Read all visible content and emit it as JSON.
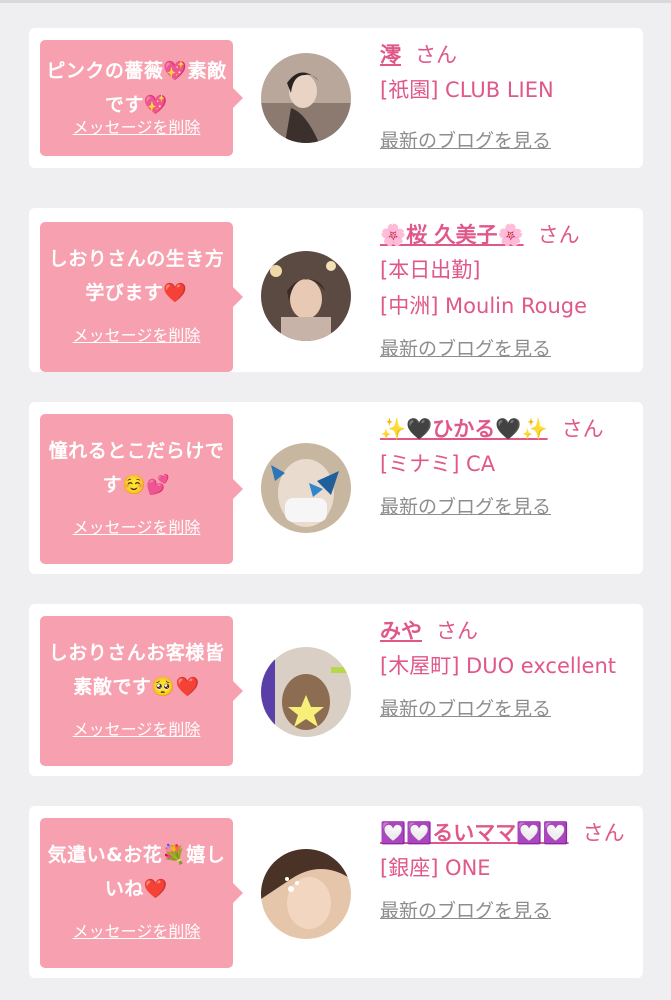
{
  "common": {
    "delete_label": "メッセージを削除",
    "blog_label": "最新のブログを見る",
    "honorific": "さん"
  },
  "colors": {
    "bubble": "#f7a1b0",
    "accent": "#e0578a",
    "muted": "#8d8d8d",
    "background": "#efeff1"
  },
  "cards": [
    {
      "message": "ピンクの薔薇💖素敵です💖",
      "name": "澪",
      "details": [
        "[祇園] CLUB LIEN"
      ]
    },
    {
      "message": "しおりさんの生き方学びます❤️",
      "name": "🌸桜 久美子🌸",
      "details": [
        "[本日出勤]",
        "[中洲] Moulin Rouge"
      ]
    },
    {
      "message": "憧れるとこだらけです☺️💕",
      "name": "✨🖤ひかる🖤✨",
      "details": [
        "[ミナミ] CA"
      ]
    },
    {
      "message": "しおりさんお客様皆素敵です🥺❤️",
      "name": "みや",
      "details": [
        "[木屋町] DUO excellent"
      ]
    },
    {
      "message": "気遣い&お花💐嬉しいね❤️",
      "name": "💟💟るいママ💟💟",
      "details": [
        "[銀座] ONE"
      ]
    }
  ]
}
